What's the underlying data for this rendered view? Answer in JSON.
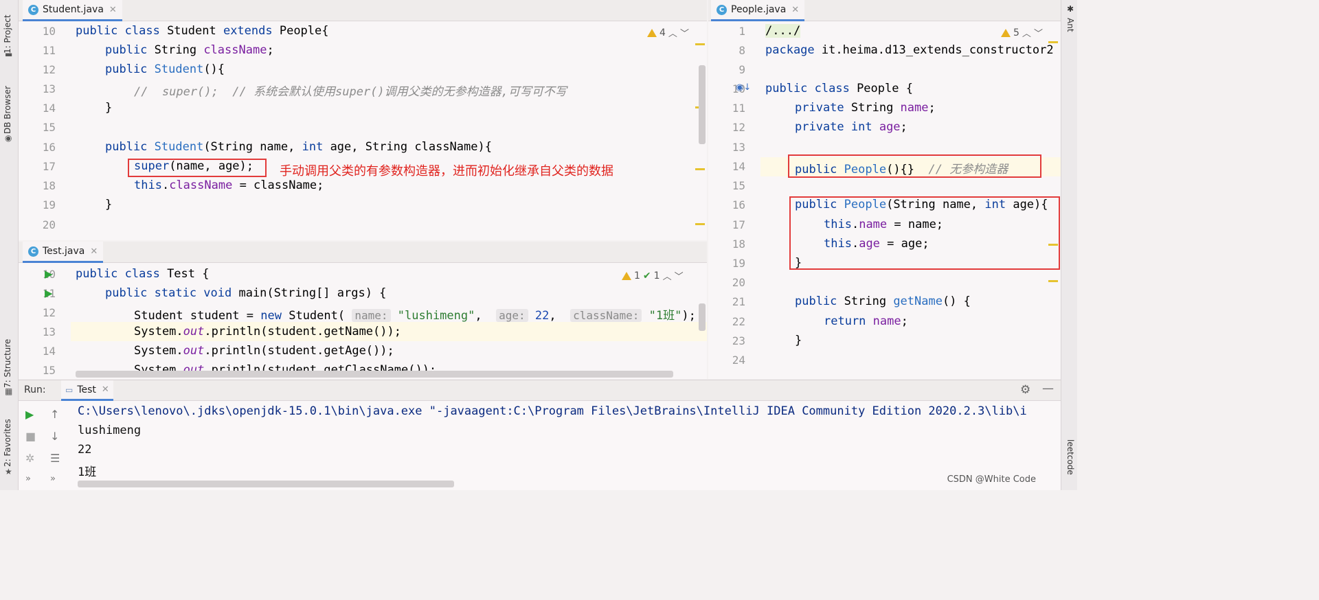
{
  "left_tools": {
    "project": "1: Project",
    "db_browser": "DB Browser",
    "structure": "7: Structure",
    "favorites": "2: Favorites"
  },
  "right_tools": {
    "ant": "Ant",
    "leetcode": "leetcode"
  },
  "student_editor": {
    "tab": "Student.java",
    "warnings": "4",
    "line_numbers": [
      "10",
      "11",
      "12",
      "13",
      "14",
      "15",
      "16",
      "17",
      "18",
      "19",
      "20"
    ],
    "lines": {
      "l10": [
        "public class ",
        "Student ",
        "extends ",
        "People{"
      ],
      "l11": [
        "public ",
        "String ",
        "className",
        ";"
      ],
      "l12": [
        "public ",
        "Student",
        "(){"
      ],
      "l13": "//  super();  // 系统会默认使用super()调用父类的无参构造器,可写可不写",
      "l14": "}",
      "l16": [
        "public ",
        "Student",
        "(String name, ",
        "int ",
        "age, String className){"
      ],
      "l17": [
        "super",
        "(name, age);"
      ],
      "l18": [
        "this",
        ".",
        "className",
        " = className;"
      ],
      "l19": "}"
    },
    "annotation": "手动调用父类的有参数构造器，进而初始化继承自父类的数据"
  },
  "test_editor": {
    "tab": "Test.java",
    "warnings": "1",
    "checks": "1",
    "line_numbers": [
      "10",
      "11",
      "12",
      "13",
      "14",
      "15"
    ],
    "lines": {
      "l10": [
        "public class ",
        "Test {"
      ],
      "l11": [
        "public static void ",
        "main",
        "(String[] args) {"
      ],
      "l12": [
        "Student ",
        "student",
        " = ",
        "new ",
        "Student( ",
        "name:",
        " ",
        "\"lushimeng\"",
        ",  ",
        "age:",
        " ",
        "22",
        ",  ",
        "className:",
        " ",
        "\"1班\"",
        ");"
      ],
      "l13": [
        "System.",
        "out",
        ".println(",
        "student",
        ".getName());"
      ],
      "l14": [
        "System.",
        "out",
        ".println(",
        "student",
        ".getAge());"
      ],
      "l15": [
        "System.",
        "out",
        ".println(",
        "student",
        ".getClassName());"
      ]
    }
  },
  "people_editor": {
    "tab": "People.java",
    "warnings": "5",
    "line_numbers": [
      "1",
      "8",
      "9",
      "10",
      "11",
      "12",
      "13",
      "14",
      "15",
      "16",
      "17",
      "18",
      "19",
      "20",
      "21",
      "22",
      "23",
      "24"
    ],
    "lines": {
      "l1": "/.../",
      "l8": [
        "package ",
        "it.heima.d13_extends_constructor2"
      ],
      "l10": [
        "public class ",
        "People {"
      ],
      "l11": [
        "private ",
        "String ",
        "name",
        ";"
      ],
      "l12": [
        "private int ",
        "age",
        ";"
      ],
      "l14": [
        "public ",
        "People",
        "(){}  ",
        "// 无参构造器"
      ],
      "l16": [
        "public ",
        "People",
        "(String name, ",
        "int ",
        "age){"
      ],
      "l17": [
        "this",
        ".",
        "name",
        " = name;"
      ],
      "l18": [
        "this",
        ".",
        "age",
        " = age;"
      ],
      "l19": "}",
      "l21": [
        "public ",
        "String ",
        "getName",
        "() {"
      ],
      "l22": [
        "return ",
        "name",
        ";"
      ],
      "l23": "}"
    }
  },
  "run_panel": {
    "label": "Run:",
    "tab": "Test",
    "output": [
      "C:\\Users\\lenovo\\.jdks\\openjdk-15.0.1\\bin\\java.exe \"-javaagent:C:\\Program Files\\JetBrains\\IntelliJ IDEA Community Edition 2020.2.3\\lib\\i",
      "lushimeng",
      "22",
      "1班"
    ]
  },
  "watermark": "CSDN @White Code",
  "colors": {
    "keyword": "#0a3d9c",
    "field": "#7a1fa0",
    "string": "#2e7d32",
    "annotation_red": "#e0241f",
    "tab_underline": "#4a83d4"
  }
}
